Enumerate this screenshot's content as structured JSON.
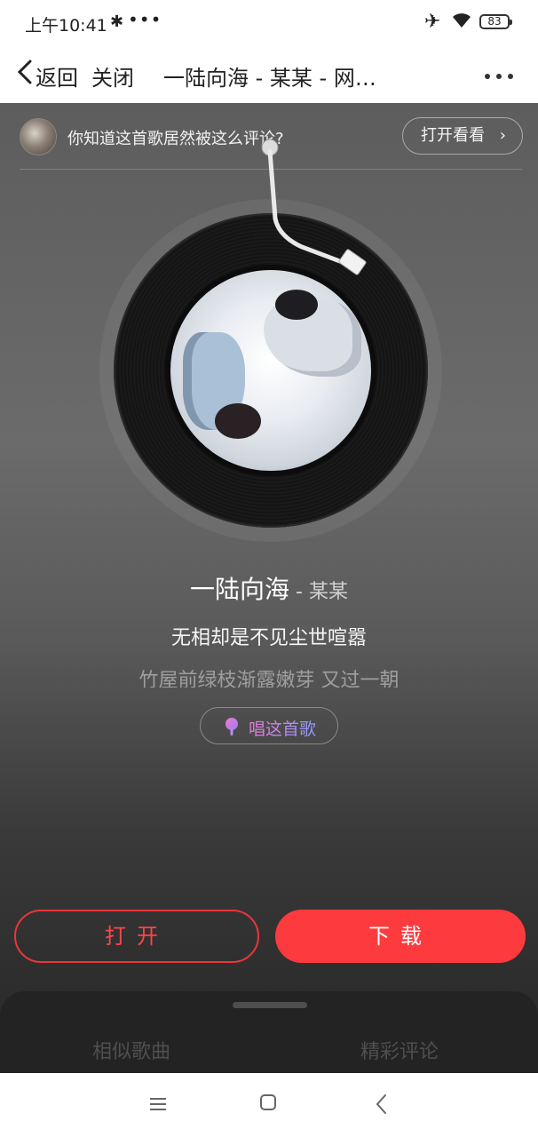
{
  "status_bar": {
    "time": "上午10:41",
    "dots": "•••",
    "battery": "83",
    "icons": [
      "bluetooth-icon",
      "airplane-icon",
      "wifi-icon",
      "battery-icon"
    ]
  },
  "nav": {
    "back_label": "返回",
    "close_label": "关闭",
    "title": "一陆向海 - 某某 - 网易云音乐"
  },
  "banner": {
    "text": "你知道这首歌居然被这么评论?",
    "button_label": "打开看看",
    "button_chevron": "›"
  },
  "song": {
    "title": "一陆向海",
    "separator": " - ",
    "artist": "某某"
  },
  "lyrics": {
    "current": "无相却是不见尘世喧嚣",
    "next": "竹屋前绿枝渐露嫩芽 又过一朝"
  },
  "sing_button": {
    "label": "唱这首歌"
  },
  "actions": {
    "open_label": "打开",
    "download_label": "下载"
  },
  "sheet": {
    "tabs": [
      "相似歌曲",
      "精彩评论"
    ]
  },
  "colors": {
    "accent_red": "#fd3a3e",
    "background_dark": "#262626"
  }
}
